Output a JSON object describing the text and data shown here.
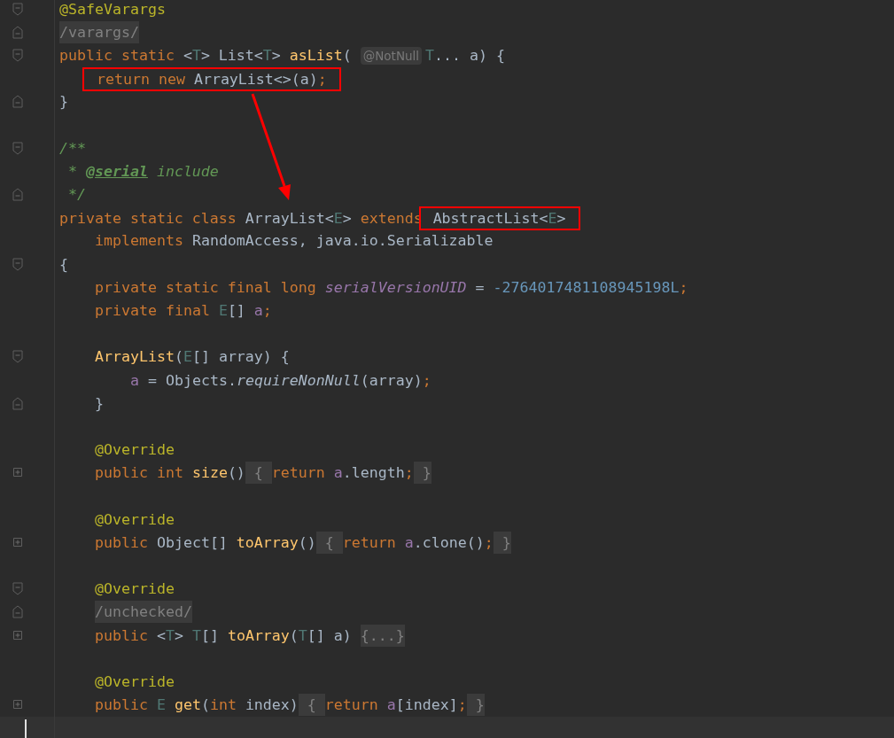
{
  "editor": {
    "callout_arrow": true,
    "lines": [
      {
        "fold": {
          "kind": "open"
        },
        "tokens": [
          {
            "kind": "annotation",
            "text": "@SafeVarargs"
          }
        ]
      },
      {
        "fold": {
          "kind": "close"
        },
        "tokens": [
          {
            "kind": "folded_comment",
            "text": "/varargs/"
          }
        ]
      },
      {
        "fold": {
          "kind": "open"
        },
        "tokens": [
          {
            "kind": "keyword",
            "text": "public static "
          },
          {
            "kind": "plain",
            "text": "<"
          },
          {
            "kind": "type_param",
            "text": "T"
          },
          {
            "kind": "plain",
            "text": "> List<"
          },
          {
            "kind": "type_param",
            "text": "T"
          },
          {
            "kind": "plain",
            "text": "> "
          },
          {
            "kind": "function",
            "text": "asList"
          },
          {
            "kind": "plain",
            "text": "( "
          },
          {
            "kind": "hint",
            "text": "@NotNull"
          },
          {
            "kind": "type_param",
            "text": "T"
          },
          {
            "kind": "plain",
            "text": "... a) {"
          }
        ],
        "children": [
          {
            "tokens": [
              {
                "kind": "keyword",
                "text": "return new ",
                "boxed": true
              },
              {
                "kind": "plain",
                "text": "ArrayList<>(a)",
                "boxed": true
              },
              {
                "kind": "keyword",
                "text": ";",
                "boxed": true
              }
            ]
          }
        ]
      },
      {
        "fold": {
          "kind": "close"
        },
        "tokens": [
          {
            "kind": "plain",
            "text": "}"
          }
        ]
      },
      {
        "fold": {
          "kind": "open"
        },
        "space_before": true,
        "tokens": [
          {
            "kind": "doc",
            "text": "/**"
          }
        ]
      },
      {
        "tokens": [
          {
            "kind": "doc",
            "text": " * "
          },
          {
            "kind": "doc_tag",
            "text": "@serial"
          },
          {
            "kind": "doc",
            "text": " include"
          }
        ]
      },
      {
        "fold": {
          "kind": "close"
        },
        "tokens": [
          {
            "kind": "doc",
            "text": " */"
          }
        ]
      },
      {
        "tokens": [
          {
            "kind": "keyword",
            "text": "private static class "
          },
          {
            "kind": "plain",
            "text": "ArrayList<"
          },
          {
            "kind": "type_param",
            "text": "E"
          },
          {
            "kind": "plain",
            "text": "> "
          },
          {
            "kind": "keyword",
            "text": "extends "
          },
          {
            "kind": "plain",
            "text": "AbstractList<",
            "boxed": true
          },
          {
            "kind": "type_param",
            "text": "E",
            "boxed": true
          },
          {
            "kind": "plain",
            "text": ">",
            "boxed": true
          }
        ],
        "children": [
          {
            "tokens": [
              {
                "kind": "keyword",
                "text": "implements "
              },
              {
                "kind": "plain",
                "text": "RandomAccess, java.io.Serializable"
              }
            ]
          }
        ]
      },
      {
        "fold": {
          "kind": "open"
        },
        "tokens": [
          {
            "kind": "plain",
            "text": "{"
          }
        ],
        "children": [
          {
            "tokens": [
              {
                "kind": "keyword",
                "text": "private static final long "
              },
              {
                "kind": "static_field",
                "text": "serialVersionUID"
              },
              {
                "kind": "plain",
                "text": " = "
              },
              {
                "kind": "number",
                "text": "-2764017481108945198L"
              },
              {
                "kind": "keyword",
                "text": ";"
              }
            ]
          },
          {
            "tokens": [
              {
                "kind": "keyword",
                "text": "private final "
              },
              {
                "kind": "type_param",
                "text": "E"
              },
              {
                "kind": "plain",
                "text": "[] "
              },
              {
                "kind": "field",
                "text": "a"
              },
              {
                "kind": "keyword",
                "text": ";"
              }
            ]
          },
          {
            "fold": {
              "kind": "open"
            },
            "space_before": true,
            "tokens": [
              {
                "kind": "function",
                "text": "ArrayList"
              },
              {
                "kind": "plain",
                "text": "("
              },
              {
                "kind": "type_param",
                "text": "E"
              },
              {
                "kind": "plain",
                "text": "[] array) {"
              }
            ],
            "children": [
              {
                "tokens": [
                  {
                    "kind": "field",
                    "text": "a"
                  },
                  {
                    "kind": "plain",
                    "text": " = Objects."
                  },
                  {
                    "kind": "static_call",
                    "text": "requireNonNull"
                  },
                  {
                    "kind": "plain",
                    "text": "(array)"
                  },
                  {
                    "kind": "keyword",
                    "text": ";"
                  }
                ]
              }
            ]
          },
          {
            "fold": {
              "kind": "close"
            },
            "tokens": [
              {
                "kind": "plain",
                "text": "}"
              }
            ]
          },
          {
            "space_before": true,
            "tokens": [
              {
                "kind": "annotation",
                "text": "@Override"
              }
            ]
          },
          {
            "fold": {
              "kind": "collapsed"
            },
            "tokens": [
              {
                "kind": "keyword",
                "text": "public int "
              },
              {
                "kind": "function",
                "text": "size"
              },
              {
                "kind": "plain",
                "text": "()"
              },
              {
                "kind": "folded",
                "text": " { "
              },
              {
                "kind": "keyword",
                "text": "return "
              },
              {
                "kind": "field",
                "text": "a"
              },
              {
                "kind": "plain",
                "text": ".length"
              },
              {
                "kind": "keyword",
                "text": ";"
              },
              {
                "kind": "folded",
                "text": " }"
              }
            ]
          },
          {
            "space_before": true,
            "tokens": [
              {
                "kind": "annotation",
                "text": "@Override"
              }
            ]
          },
          {
            "fold": {
              "kind": "collapsed"
            },
            "tokens": [
              {
                "kind": "keyword",
                "text": "public "
              },
              {
                "kind": "plain",
                "text": "Object[] "
              },
              {
                "kind": "function",
                "text": "toArray"
              },
              {
                "kind": "plain",
                "text": "()"
              },
              {
                "kind": "folded",
                "text": " { "
              },
              {
                "kind": "keyword",
                "text": "return "
              },
              {
                "kind": "field",
                "text": "a"
              },
              {
                "kind": "plain",
                "text": ".clone()"
              },
              {
                "kind": "keyword",
                "text": ";"
              },
              {
                "kind": "folded",
                "text": " }"
              }
            ]
          },
          {
            "fold": {
              "kind": "open"
            },
            "space_before": true,
            "tokens": [
              {
                "kind": "annotation",
                "text": "@Override"
              }
            ]
          },
          {
            "fold": {
              "kind": "close"
            },
            "tokens": [
              {
                "kind": "folded_comment",
                "text": "/unchecked/"
              }
            ]
          },
          {
            "fold": {
              "kind": "collapsed"
            },
            "tokens": [
              {
                "kind": "keyword",
                "text": "public "
              },
              {
                "kind": "plain",
                "text": "<"
              },
              {
                "kind": "type_param",
                "text": "T"
              },
              {
                "kind": "plain",
                "text": "> "
              },
              {
                "kind": "type_param",
                "text": "T"
              },
              {
                "kind": "plain",
                "text": "[] "
              },
              {
                "kind": "function",
                "text": "toArray"
              },
              {
                "kind": "plain",
                "text": "("
              },
              {
                "kind": "type_param",
                "text": "T"
              },
              {
                "kind": "plain",
                "text": "[] a) "
              },
              {
                "kind": "folded",
                "text": "{...}"
              }
            ]
          },
          {
            "space_before": true,
            "tokens": [
              {
                "kind": "annotation",
                "text": "@Override"
              }
            ]
          },
          {
            "fold": {
              "kind": "collapsed"
            },
            "tokens": [
              {
                "kind": "keyword",
                "text": "public "
              },
              {
                "kind": "type_param",
                "text": "E "
              },
              {
                "kind": "function",
                "text": "get"
              },
              {
                "kind": "plain",
                "text": "("
              },
              {
                "kind": "keyword",
                "text": "int "
              },
              {
                "kind": "plain",
                "text": "index)"
              },
              {
                "kind": "folded",
                "text": " { "
              },
              {
                "kind": "keyword",
                "text": "return "
              },
              {
                "kind": "field",
                "text": "a"
              },
              {
                "kind": "plain",
                "text": "[index]"
              },
              {
                "kind": "keyword",
                "text": ";"
              },
              {
                "kind": "folded",
                "text": " }"
              }
            ]
          }
        ]
      },
      {
        "current": true
      }
    ]
  }
}
